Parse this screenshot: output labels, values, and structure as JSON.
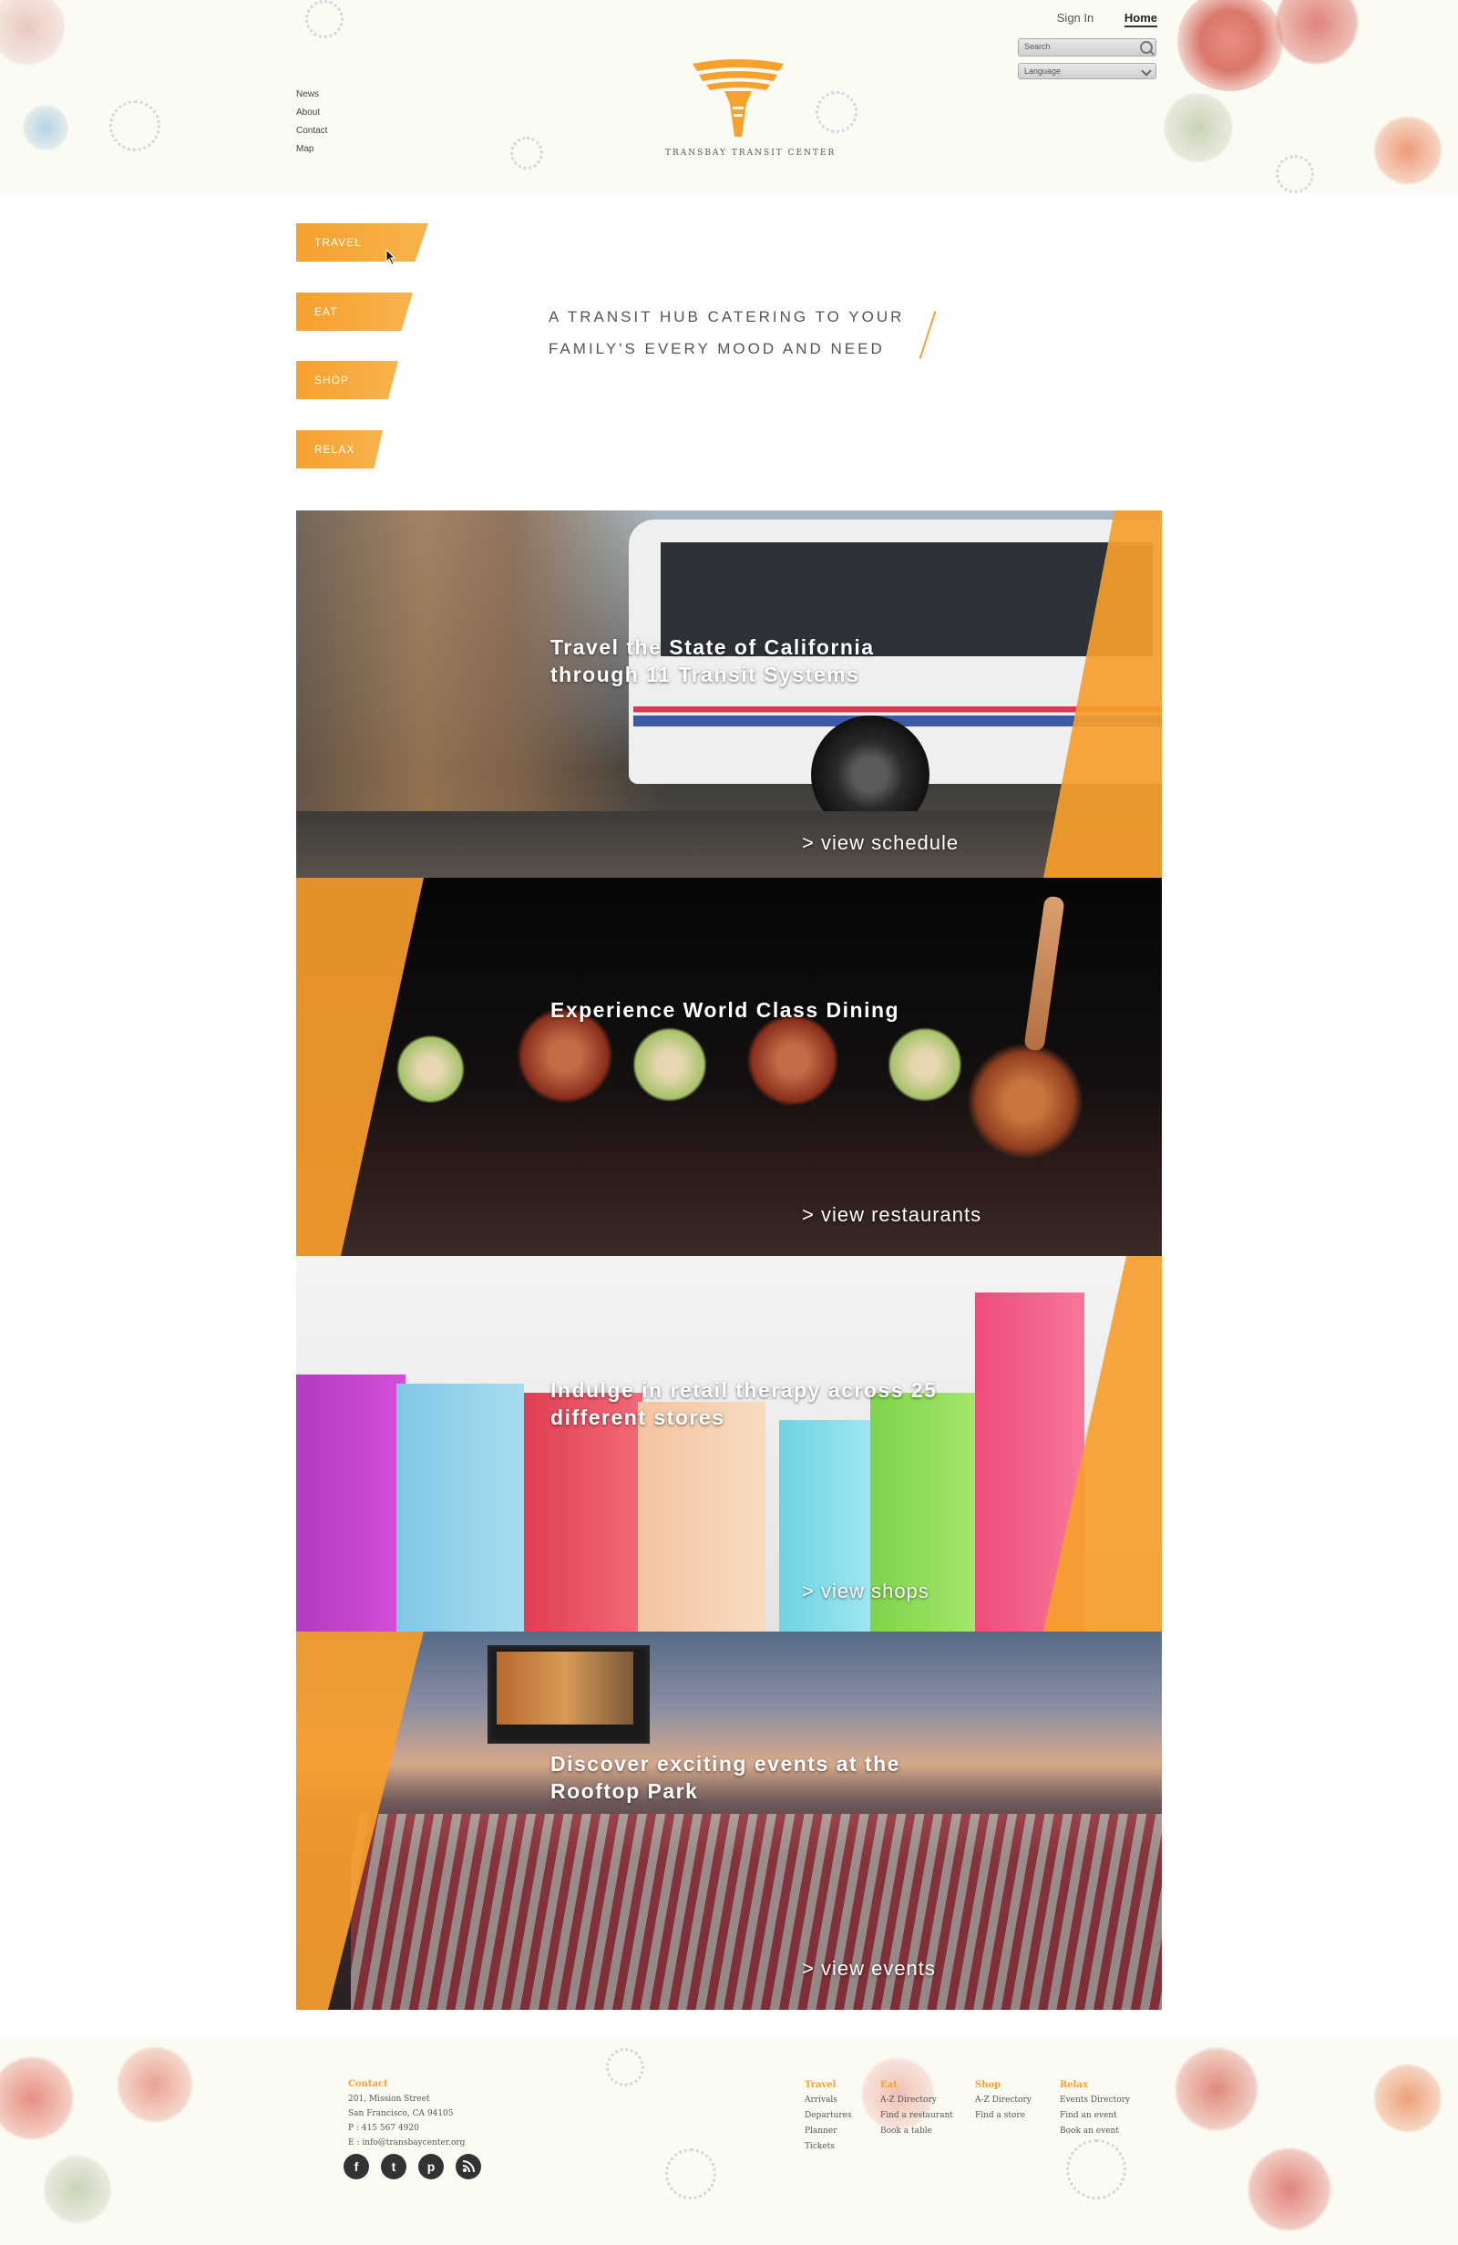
{
  "header": {
    "side_nav": [
      "News",
      "About",
      "Contact",
      "Map"
    ],
    "logo_text": "TRANSBAY TRANSIT CENTER",
    "sign_in": "Sign In",
    "home": "Home",
    "search_placeholder": "Search",
    "language_label": "Language"
  },
  "categories": [
    "TRAVEL",
    "EAT",
    "SHOP",
    "RELAX"
  ],
  "tagline": "A TRANSIT HUB CATERING TO YOUR FAMILY'S EVERY MOOD AND NEED",
  "panels": [
    {
      "title": "Travel the State of California through 11 Transit Systems",
      "link": "> view schedule"
    },
    {
      "title": "Experience World Class Dining",
      "link": "> view restaurants"
    },
    {
      "title": "Indulge in retail therapy across 25 different stores",
      "link": "> view shops"
    },
    {
      "title": "Discover exciting events at the Rooftop Park",
      "link": "> view events"
    }
  ],
  "footer": {
    "contact": {
      "heading": "Contact",
      "address1": "201, Mission Street",
      "address2": "San Francisco, CA 94105",
      "phone": "P : 415 567 4920",
      "email": "E : info@transbaycenter.org"
    },
    "columns": [
      {
        "heading": "Travel",
        "items": [
          "Arrivals",
          "Departures",
          "Planner",
          "Tickets"
        ]
      },
      {
        "heading": "Eat",
        "items": [
          "A-Z Directory",
          "Find a restaurant",
          "Book a table"
        ]
      },
      {
        "heading": "Shop",
        "items": [
          "A-Z Directory",
          "Find a store"
        ]
      },
      {
        "heading": "Relax",
        "items": [
          "Events Directory",
          "Find an event",
          "Book an event"
        ]
      }
    ],
    "social_icons": [
      "facebook-icon",
      "twitter-icon",
      "pinterest-icon",
      "rss-icon"
    ]
  },
  "colors": {
    "accent": "#f5a12d",
    "text": "#555555",
    "background": "#fbfaf3"
  }
}
